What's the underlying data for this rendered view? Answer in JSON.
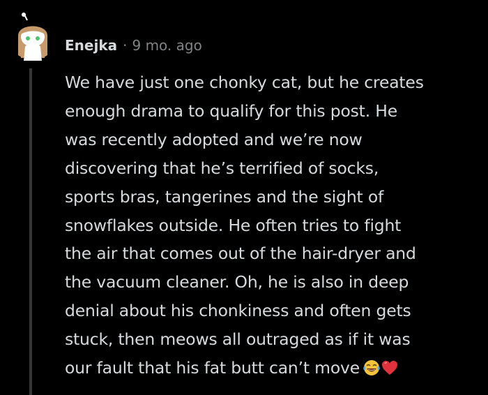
{
  "comment": {
    "author": "Enejka",
    "separator": "·",
    "time_ago": "9 mo. ago",
    "body_lines": [
      "We have just one chonky cat, but he creates",
      "enough drama to qualify for this post. He",
      "was recently adopted and we’re now",
      "discovering that he’s terrified of socks,",
      "sports bras, tangerines and the sight of",
      "snowflakes outside. He often tries to fight",
      "the air that comes out of the hair-dryer and",
      "the vacuum cleaner. Oh, he is also in deep",
      "denial about his chonkiness and often gets",
      "stuck, then meows all outraged as if it was",
      "our fault that his fat butt can’t move"
    ],
    "emojis": [
      "face-with-tears-of-joy",
      "red-heart"
    ]
  },
  "colors": {
    "background": "#000000",
    "body_text": "#d7dadc",
    "meta_text": "#818384",
    "thread_line": "#343536"
  }
}
